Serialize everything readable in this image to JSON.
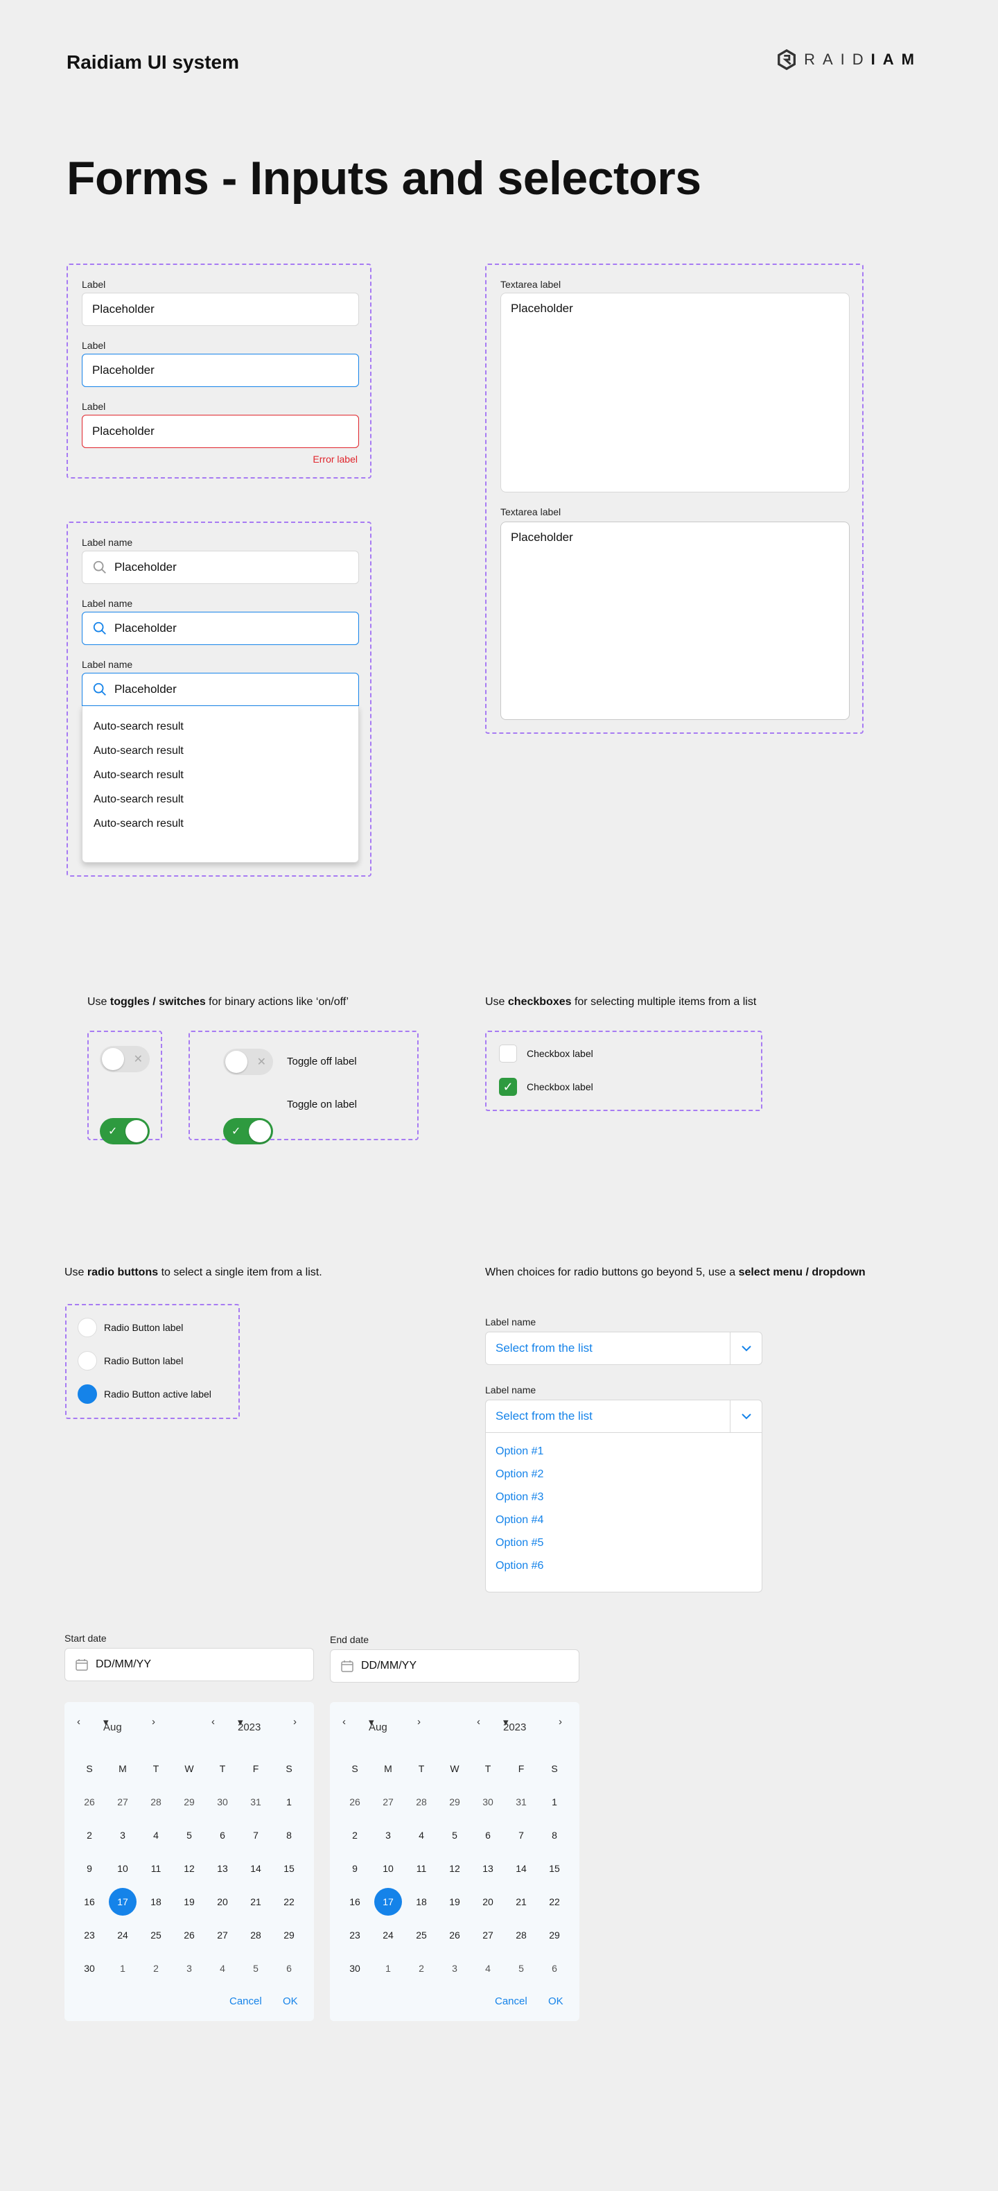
{
  "header": {
    "brand": "Raidiam UI system",
    "logo_text_light": "RAID",
    "logo_text_bold": "IAM"
  },
  "page_title": "Forms - Inputs and selectors",
  "inputs": {
    "label": "Label",
    "placeholder": "Placeholder",
    "error_label": "Error label"
  },
  "textareas": {
    "label": "Textarea label",
    "placeholder": "Placeholder"
  },
  "search": {
    "label": "Label name",
    "placeholder": "Placeholder",
    "results": [
      "Auto-search result",
      "Auto-search result",
      "Auto-search result",
      "Auto-search result",
      "Auto-search result"
    ]
  },
  "toggles": {
    "note_pre": "Use ",
    "note_bold": "toggles / switches",
    "note_post": " for binary actions like ‘on/off’",
    "off_label": "Toggle off label",
    "on_label": "Toggle on label"
  },
  "checkboxes": {
    "note_pre": "Use ",
    "note_bold": "checkboxes",
    "note_post": " for selecting multiple items from a list",
    "label": "Checkbox label"
  },
  "radios": {
    "note_pre": "Use ",
    "note_bold": "radio buttons",
    "note_post": " to select a single item from a list.",
    "label": "Radio Button label",
    "active_label": "Radio Button active label"
  },
  "dropdown": {
    "note_pre": "When choices for radio buttons go beyond 5, use a ",
    "note_bold": "select menu / dropdown",
    "label": "Label name",
    "placeholder": "Select from the list",
    "options": [
      "Option #1",
      "Option #2",
      "Option #3",
      "Option #4",
      "Option #5",
      "Option #6"
    ]
  },
  "dates": {
    "start_label": "Start date",
    "end_label": "End date",
    "placeholder": "DD/MM/YY",
    "month": "Aug",
    "year": "2023",
    "weekdays": [
      "S",
      "M",
      "T",
      "W",
      "T",
      "F",
      "S"
    ],
    "days": [
      "26",
      "27",
      "28",
      "29",
      "30",
      "31",
      "1",
      "2",
      "3",
      "4",
      "5",
      "6",
      "7",
      "8",
      "9",
      "10",
      "11",
      "12",
      "13",
      "14",
      "15",
      "16",
      "17",
      "18",
      "19",
      "20",
      "21",
      "22",
      "23",
      "24",
      "25",
      "26",
      "27",
      "28",
      "29",
      "30",
      "1",
      "2",
      "3",
      "4",
      "5",
      "6"
    ],
    "selected_day": "17",
    "cancel": "Cancel",
    "ok": "OK"
  },
  "colors": {
    "accent": "#1583e9",
    "success": "#2e9a3f",
    "error": "#e0242b",
    "dash": "#a77bf3"
  }
}
